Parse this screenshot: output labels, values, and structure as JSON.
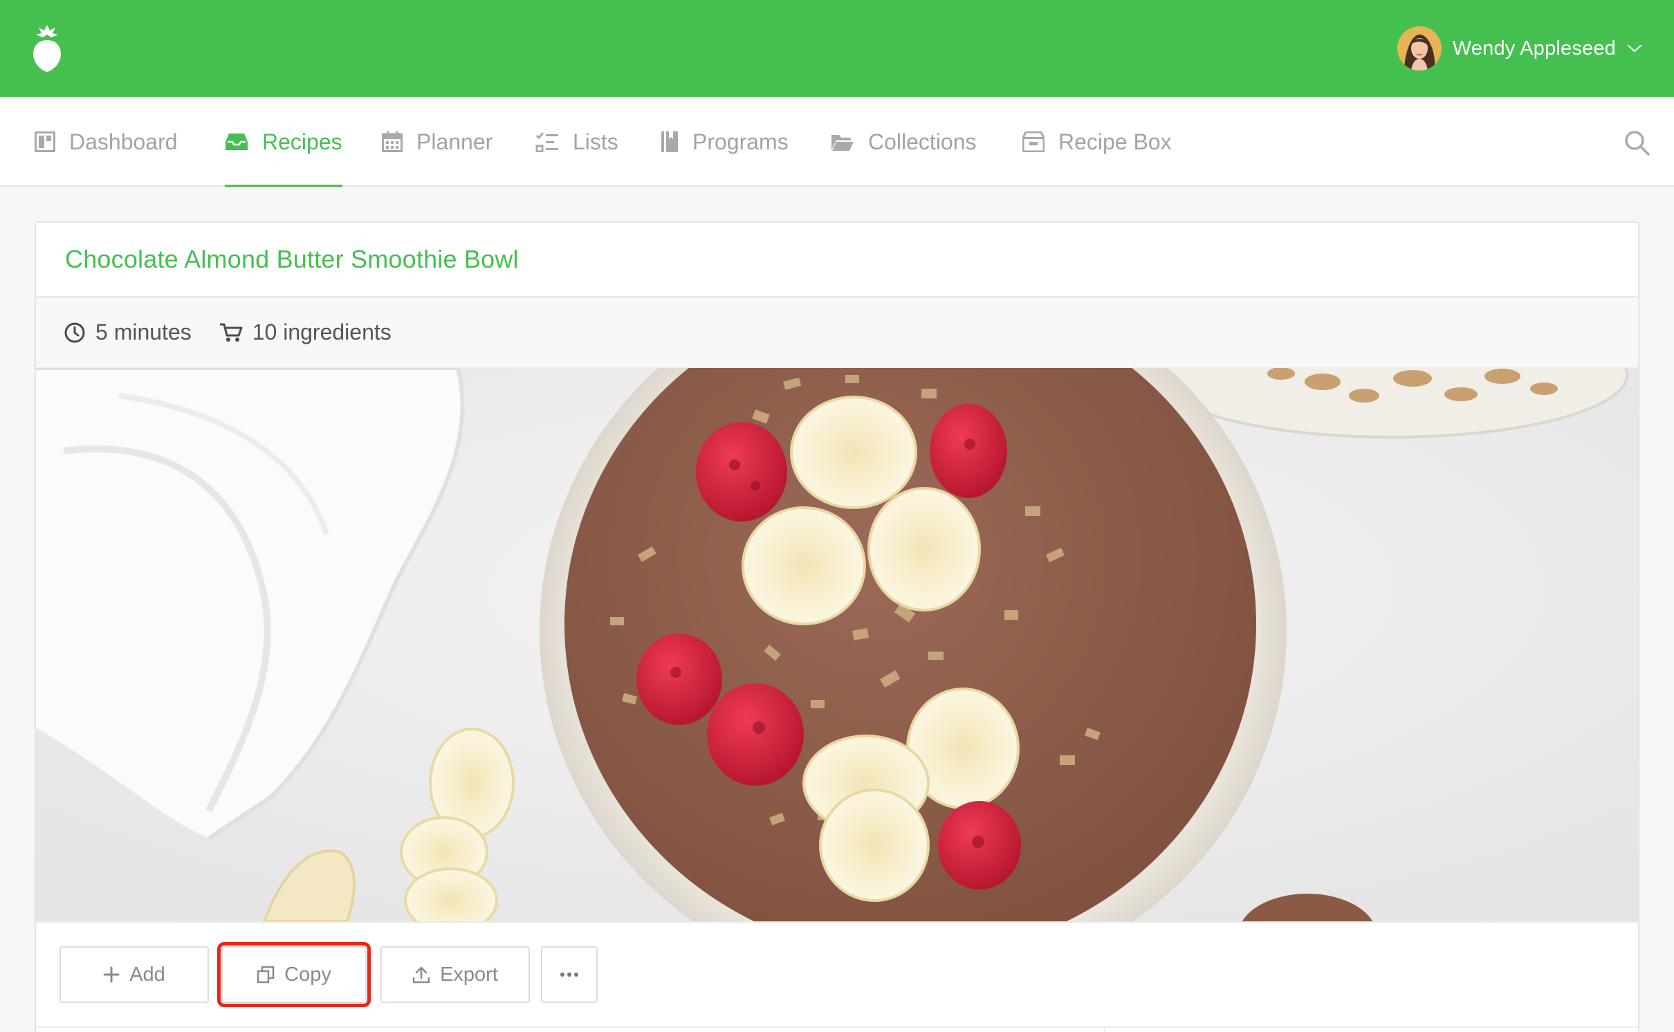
{
  "header": {
    "logo_icon": "strawberry-logo-icon",
    "user_name": "Wendy Appleseed",
    "colors": {
      "brand_green": "#45bf4f"
    }
  },
  "nav": {
    "items": [
      {
        "label": "Dashboard",
        "icon": "dashboard-icon",
        "active": false
      },
      {
        "label": "Recipes",
        "icon": "recipes-tray-icon",
        "active": true
      },
      {
        "label": "Planner",
        "icon": "calendar-icon",
        "active": false
      },
      {
        "label": "Lists",
        "icon": "checklist-icon",
        "active": false
      },
      {
        "label": "Programs",
        "icon": "book-icon",
        "active": false
      },
      {
        "label": "Collections",
        "icon": "folder-icon",
        "active": false
      },
      {
        "label": "Recipe Box",
        "icon": "box-icon",
        "active": false
      }
    ],
    "search_icon": "search-icon"
  },
  "recipe": {
    "title": "Chocolate Almond Butter Smoothie Bowl",
    "time": "5 minutes",
    "ingredients": "10 ingredients",
    "image_subject": "smoothie-bowl-photo"
  },
  "actions": {
    "add_label": "Add",
    "copy_label": "Copy",
    "export_label": "Export",
    "more_icon": "more-dots-icon",
    "highlighted": "Copy",
    "highlight_color": "#e8261a"
  }
}
